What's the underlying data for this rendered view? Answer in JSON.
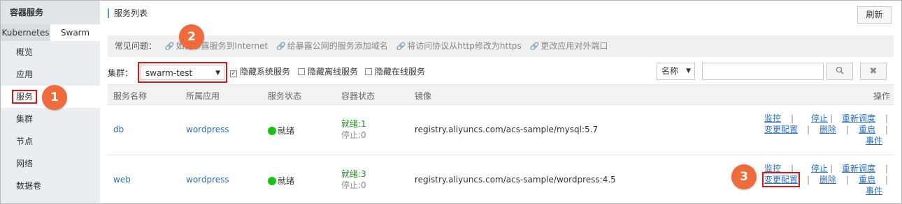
{
  "sidebar": {
    "title": "容器服务",
    "tabs": [
      "Kubernetes",
      "Swarm"
    ],
    "items": [
      {
        "label": "概览"
      },
      {
        "label": "应用"
      },
      {
        "label": "服务"
      },
      {
        "label": "集群"
      },
      {
        "label": "节点"
      },
      {
        "label": "网络"
      },
      {
        "label": "数据卷"
      }
    ]
  },
  "markers": [
    "1",
    "2",
    "3"
  ],
  "header": {
    "title": "服务列表",
    "refresh_label": "刷新"
  },
  "faq": {
    "label": "常见问题：",
    "links": [
      "如何暴露服务到Internet",
      "给暴露公网的服务添加域名",
      "将访问协议从http修改为https",
      "更改应用对外端口"
    ]
  },
  "filters": {
    "cluster_label": "集群：",
    "cluster_value": "swarm-test",
    "checkboxes": [
      {
        "label": "隐藏系统服务",
        "checked": true
      },
      {
        "label": "隐藏离线服务",
        "checked": false
      },
      {
        "label": "隐藏在线服务",
        "checked": false
      }
    ],
    "search_field": "名称",
    "search_value": ""
  },
  "table": {
    "columns": [
      "服务名称",
      "所属应用",
      "服务状态",
      "容器状态",
      "镜像",
      "操作"
    ],
    "rows": [
      {
        "name": "db",
        "app": "wordpress",
        "status": "就绪",
        "ready": "就绪:1",
        "stopped": "停止:0",
        "image": "registry.aliyuncs.com/acs-sample/mysql:5.7",
        "ops": {
          "monitor": "监控",
          "stop": "停止",
          "reschedule": "重新调度",
          "change": "变更配置",
          "delete": "删除",
          "restart": "重启",
          "events": "事件"
        }
      },
      {
        "name": "web",
        "app": "wordpress",
        "status": "就绪",
        "ready": "就绪:3",
        "stopped": "停止:0",
        "image": "registry.aliyuncs.com/acs-sample/wordpress:4.5",
        "ops": {
          "monitor": "监控",
          "stop": "停止",
          "reschedule": "重新调度",
          "change": "变更配置",
          "delete": "删除",
          "restart": "重启",
          "events": "事件"
        }
      }
    ]
  },
  "colors": {
    "accent": "#2a6fb7",
    "highlight": "#d9161a",
    "marker": "#ee6b3b",
    "ready": "#1ac310"
  }
}
